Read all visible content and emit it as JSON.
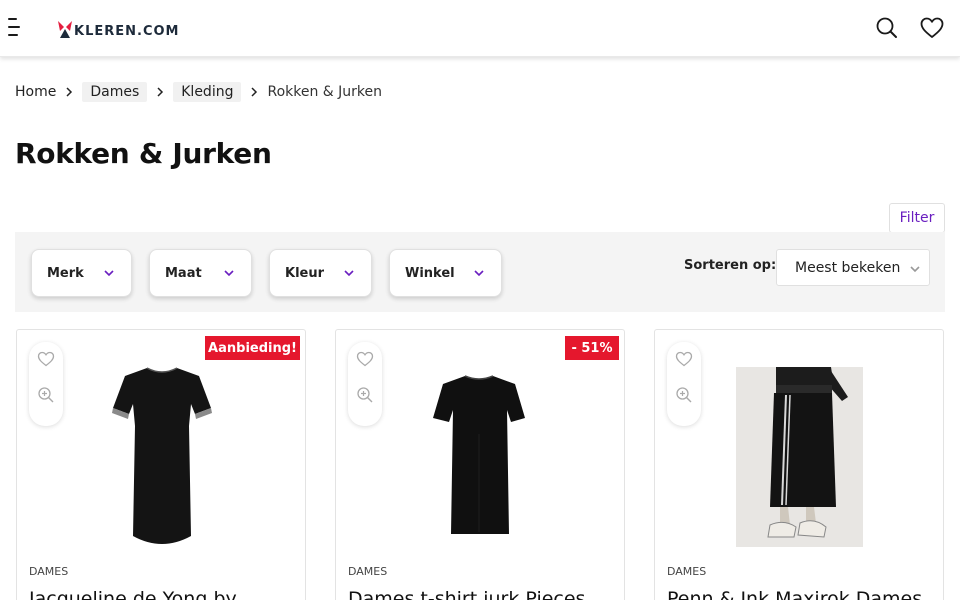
{
  "header": {
    "logo_text": "KLEREN.COM",
    "menu_icon": "hamburger-icon",
    "search_icon": "search-icon",
    "favorites_icon": "heart-icon"
  },
  "breadcrumb": {
    "items": [
      "Home",
      "Dames",
      "Kleding"
    ],
    "current": "Rokken & Jurken"
  },
  "page": {
    "title": "Rokken & Jurken"
  },
  "filter_button": "Filter",
  "filters": {
    "merk": "Merk",
    "maat": "Maat",
    "kleur": "Kleur",
    "winkel": "Winkel"
  },
  "sort": {
    "label": "Sorteren op:",
    "value": "Meest bekeken"
  },
  "colors": {
    "accent_purple": "#6a1fc0",
    "badge_red": "#e5172d",
    "logo_red": "#e41e3f"
  },
  "products": [
    {
      "badge": "Aanbieding!",
      "category": "DAMES",
      "title": "Jacqueline de Yong by"
    },
    {
      "badge": "- 51%",
      "category": "DAMES",
      "title": "Dames t-shirt jurk Pieces"
    },
    {
      "badge": "",
      "category": "DAMES",
      "title": "Penn & Ink Maxirok Dames"
    }
  ]
}
